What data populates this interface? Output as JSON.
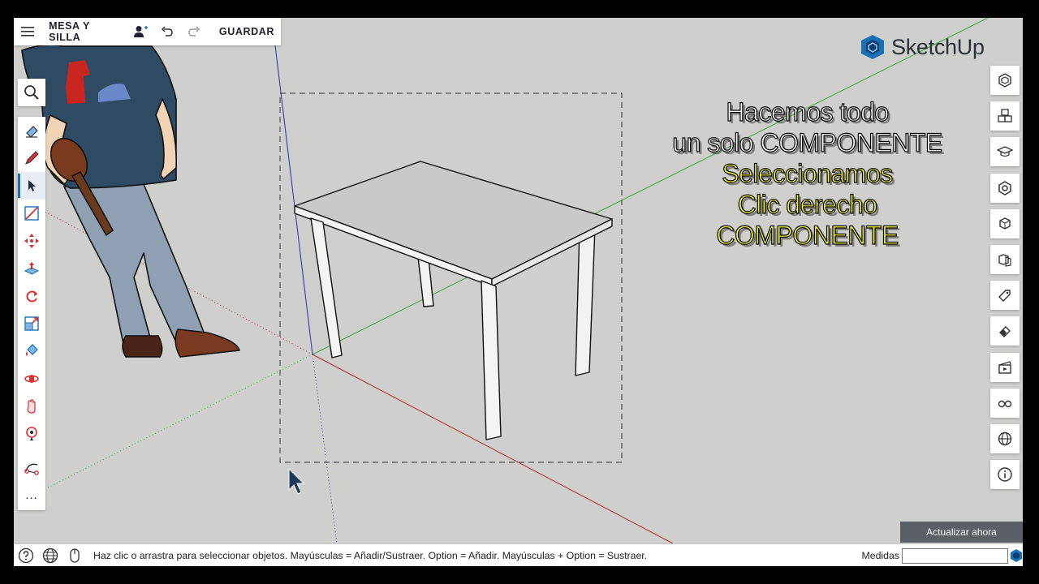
{
  "app": {
    "name": "SketchUp",
    "accent_color": "#1b6fb5"
  },
  "topbar": {
    "menu_icon": "hamburger-menu-icon",
    "title": "MESA Y SILLA",
    "add_user_icon": "add-user-icon",
    "undo_icon": "undo-icon",
    "redo_icon": "redo-icon",
    "save_label": "GUARDAR"
  },
  "left_toolbar": {
    "tools": [
      "search-icon",
      "eraser-icon",
      "pencil-icon",
      "select-arrow-icon",
      "line-icon",
      "move-icon",
      "push-pull-icon",
      "rotate-icon",
      "scale-icon",
      "paint-bucket-icon",
      "orbit-icon",
      "pan-icon",
      "position-camera-icon",
      "tape-measure-icon"
    ],
    "active_tool": "select-arrow-icon",
    "more_label": "…"
  },
  "right_toolbar": {
    "panels": [
      "entity-info-icon",
      "components-icon",
      "instructor-icon",
      "materials-icon",
      "outliner-icon",
      "styles-icon",
      "tags-icon",
      "eraser-panel-icon",
      "scenes-icon",
      "display-icon",
      "shadows-icon",
      "info-icon"
    ]
  },
  "caption": {
    "line1": "Hacemos todo",
    "line2": "un solo COMPONENTE",
    "line3": "Seleccionamos",
    "line4": "Clic derecho",
    "line5": "COMPONENTE"
  },
  "update_button": {
    "label": "Actualizar ahora"
  },
  "statusbar": {
    "help_icon": "help-icon",
    "globe_icon": "globe-icon",
    "mouse_icon": "mouse-icon",
    "message": "Haz clic o arrastra para seleccionar objetos. Mayúsculas = Añadir/Sustraer. Option = Añadir. Mayúsculas + Option = Sustraer.",
    "measures_label": "Medidas",
    "measures_value": ""
  },
  "colors": {
    "x_axis": "#b22a2a",
    "y_axis": "#3aa63a",
    "z_axis": "#2b2bb0",
    "caption_yellow": "#f5f535"
  }
}
